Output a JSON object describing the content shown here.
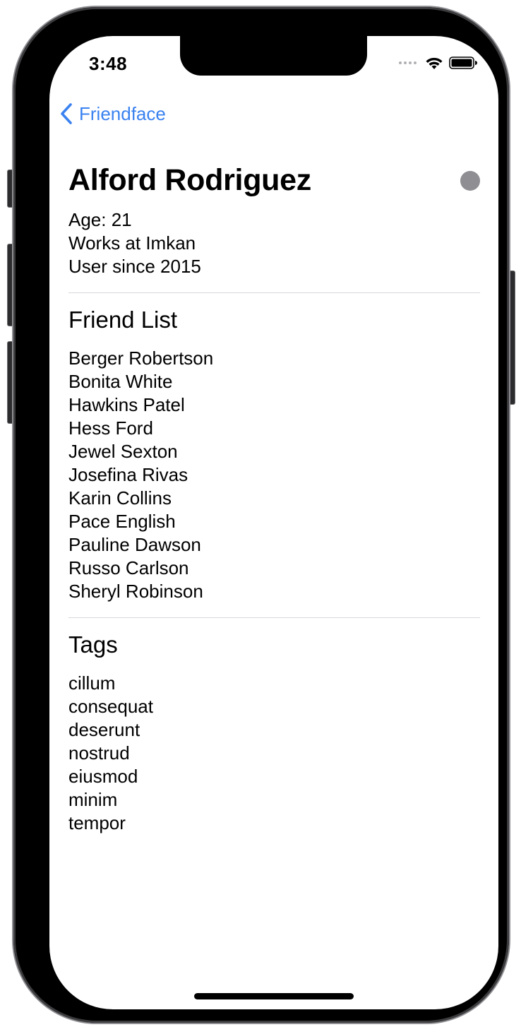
{
  "status_bar": {
    "time": "3:48"
  },
  "nav": {
    "back_label": "Friendface"
  },
  "user": {
    "name": "Alford Rodriguez",
    "active_indicator_color": "#8e8e93",
    "age_line": "Age: 21",
    "company_line": "Works at Imkan",
    "since_line": "User since 2015"
  },
  "friends_section": {
    "title": "Friend List",
    "items": [
      "Berger Robertson",
      "Bonita White",
      "Hawkins Patel",
      "Hess Ford",
      "Jewel Sexton",
      "Josefina Rivas",
      "Karin Collins",
      "Pace English",
      "Pauline Dawson",
      "Russo Carlson",
      "Sheryl Robinson"
    ]
  },
  "tags_section": {
    "title": "Tags",
    "items": [
      "cillum",
      "consequat",
      "deserunt",
      "nostrud",
      "eiusmod",
      "minim",
      "tempor"
    ]
  },
  "colors": {
    "accent": "#3a82f0"
  },
  "icons": {
    "back": "chevron-left-icon",
    "wifi": "wifi-icon",
    "battery": "battery-icon",
    "signal": "cellular-signal-icon"
  }
}
